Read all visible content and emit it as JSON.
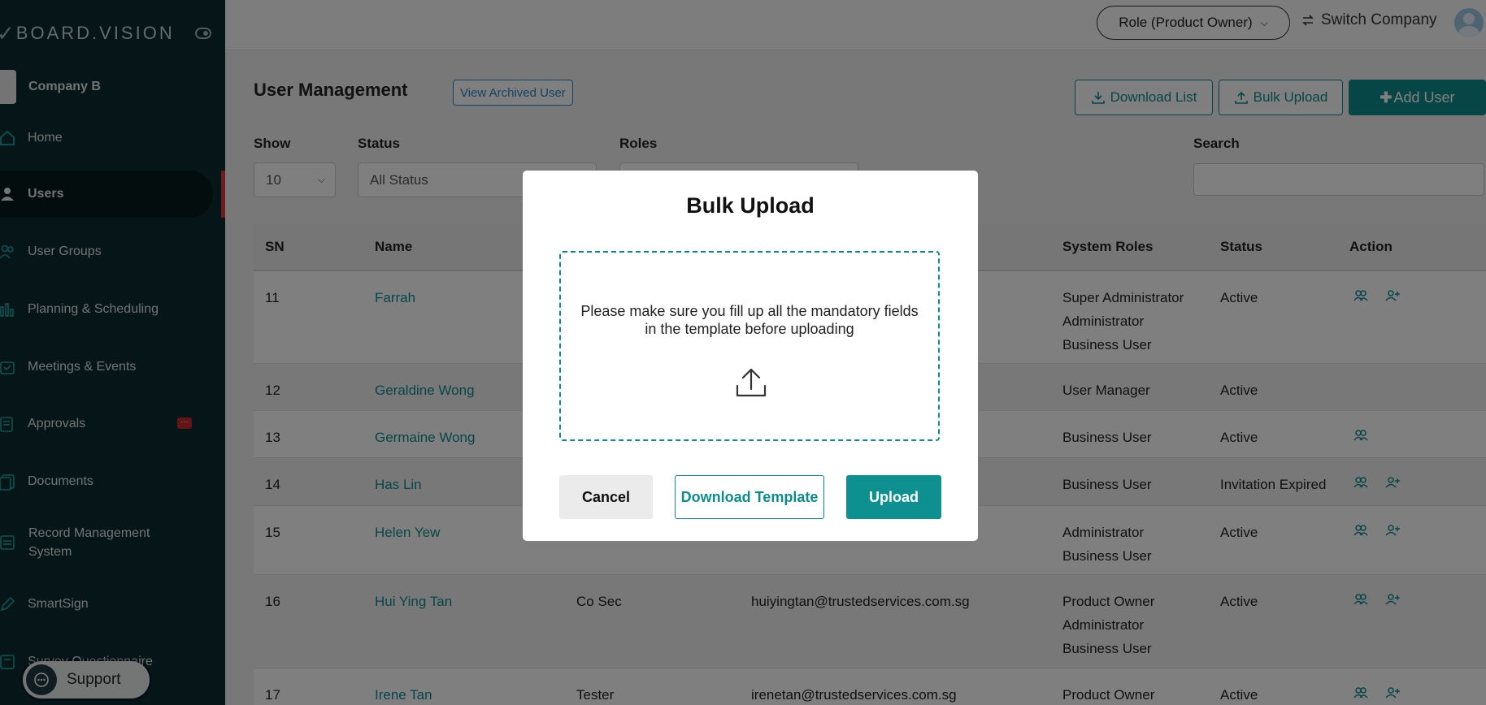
{
  "brand": {
    "logo_text": "BOARD.VISION",
    "company_name": "Company B"
  },
  "sidebar": {
    "items": [
      {
        "label": "Home",
        "icon": "home-icon"
      },
      {
        "label": "Users",
        "icon": "user-icon",
        "active": true
      },
      {
        "label": "User Groups",
        "icon": "users-icon"
      },
      {
        "label": "Planning & Scheduling",
        "icon": "chart-icon"
      },
      {
        "label": "Meetings & Events",
        "icon": "calendar-icon"
      },
      {
        "label": "Approvals",
        "icon": "approval-icon",
        "badge": "···"
      },
      {
        "label": "Documents",
        "icon": "documents-icon"
      },
      {
        "label": "Record Management",
        "label_line2": "System",
        "icon": "records-icon"
      },
      {
        "label": "SmartSign",
        "icon": "pen-icon"
      },
      {
        "label": "Survey Questionnaire",
        "icon": "survey-icon"
      }
    ],
    "support_label": "Support"
  },
  "topbar": {
    "role_label": "Role (Product Owner)",
    "switch_label": "Switch Company"
  },
  "page": {
    "title": "User Management",
    "view_archived_label": "View Archived User",
    "download_list_label": "Download List",
    "bulk_upload_label": "Bulk Upload",
    "add_user_label": "Add User"
  },
  "filters": {
    "show_label": "Show",
    "show_value": "10",
    "status_label": "Status",
    "status_value": "All Status",
    "roles_label": "Roles",
    "search_label": "Search"
  },
  "table": {
    "headers": {
      "sn": "SN",
      "name": "Name",
      "system_roles": "System Roles",
      "status": "Status",
      "action": "Action"
    },
    "rows": [
      {
        "sn": "11",
        "name": "Farrah",
        "designation": "",
        "email": "",
        "roles": [
          "Super Administrator",
          "Administrator",
          "Business User"
        ],
        "status": "Active",
        "actions": 2
      },
      {
        "sn": "12",
        "name": "Geraldine Wong",
        "designation": "",
        "email": "",
        "roles": [
          "User Manager"
        ],
        "status": "Active",
        "actions": 0
      },
      {
        "sn": "13",
        "name": "Germaine Wong",
        "designation": "",
        "email": "",
        "roles": [
          "Business User"
        ],
        "status": "Active",
        "actions": 1
      },
      {
        "sn": "14",
        "name": "Has Lin",
        "designation": "",
        "email": "",
        "roles": [
          "Business User"
        ],
        "status": "Invitation Expired",
        "actions": 2
      },
      {
        "sn": "15",
        "name": "Helen Yew",
        "designation": "",
        "email": "",
        "roles": [
          "Administrator",
          "Business User"
        ],
        "status": "Active",
        "actions": 2
      },
      {
        "sn": "16",
        "name": "Hui Ying Tan",
        "designation": "Co Sec",
        "email": "huiyingtan@trustedservices.com.sg",
        "roles": [
          "Product Owner",
          "Administrator",
          "Business User"
        ],
        "status": "Active",
        "actions": 2
      },
      {
        "sn": "17",
        "name": "Irene Tan",
        "designation": "Tester",
        "email": "irenetan@trustedservices.com.sg",
        "roles": [
          "Product Owner"
        ],
        "status": "Active",
        "actions": 2
      }
    ]
  },
  "modal": {
    "title": "Bulk Upload",
    "instructions": "Please make sure you fill up all the mandatory fields in the template before uploading",
    "cancel_label": "Cancel",
    "download_template_label": "Download Template",
    "upload_label": "Upload"
  },
  "colors": {
    "accent": "#0e8c8c",
    "sidebar_bg": "#0d2a2f",
    "active_indicator": "#d9383d",
    "link": "#2a86c8"
  }
}
